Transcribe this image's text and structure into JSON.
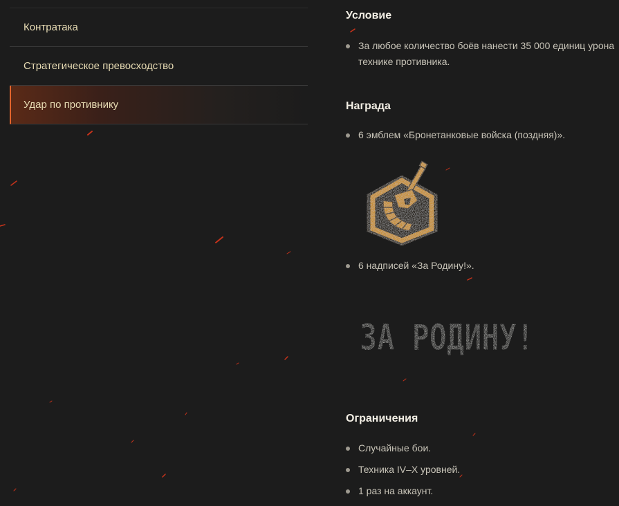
{
  "sidebar": {
    "items": [
      {
        "label": "Контратака",
        "active": false
      },
      {
        "label": "Стратегическое превосходство",
        "active": false
      },
      {
        "label": "Удар по противнику",
        "active": true
      }
    ]
  },
  "condition": {
    "title": "Условие",
    "items": [
      "За любое количество боёв нанести 35 000 единиц урона технике противника."
    ]
  },
  "reward": {
    "title": "Награда",
    "emblems_text": "6 эмблем «Бронетанковые войска (поздняя)».",
    "inscriptions_text": "6 надписей «За Родину!».",
    "inscription_image_text": "ЗА РОДИНУ!",
    "emblem_icon": "armored-forces-late-emblem-icon"
  },
  "restrictions": {
    "title": "Ограничения",
    "items": [
      "Случайные бои.",
      "Техника IV–X уровней.",
      "1 раз на аккаунт."
    ]
  },
  "colors": {
    "background": "#1c1c1c",
    "accent": "#e2642c",
    "sidebar_text": "#e8dcb4",
    "heading_text": "#f2eee4",
    "emblem_gold": "#c8902e"
  }
}
